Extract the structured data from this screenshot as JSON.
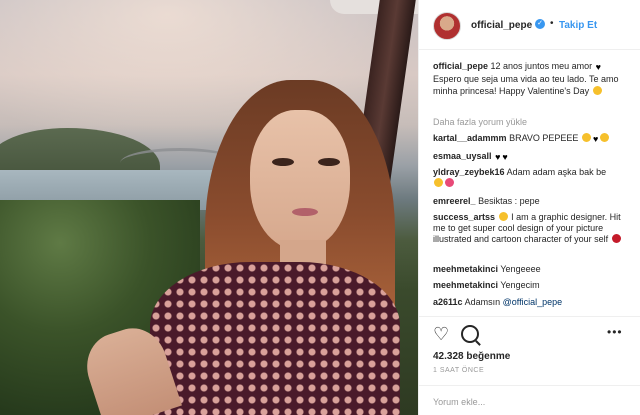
{
  "post": {
    "username": "official_pepe",
    "follow_label": "Takip Et",
    "separator": "•"
  },
  "caption": {
    "user": "official_pepe",
    "text": "12 anos juntos meu amor",
    "text2": "Espero que seja uma vida ao teu lado. Te amo minha princesa! Happy Valentine's Day"
  },
  "more_comments_label": "Daha fazla yorum yükle",
  "comments": [
    {
      "user": "kartal__adammm",
      "text": "BRAVO PEPEEE"
    },
    {
      "user": "esmaa_uysall",
      "text": ""
    },
    {
      "user": "yldray_zeybek16",
      "text": "Adam adam aşka bak be"
    },
    {
      "user": "emreerel_",
      "text": "Besiktas : pepe"
    },
    {
      "user": "success_artss",
      "text": "I am a graphic designer. Hit me to get super cool design of your picture illustrated and cartoon character of your self"
    },
    {
      "user": "meehmetakinci",
      "text": "Yengeeee"
    },
    {
      "user": "meehmetakinci",
      "text": "Yengecim"
    },
    {
      "user": "a2611c",
      "text": "Adamsın",
      "mention": "@official_pepe"
    }
  ],
  "likes_text": "42.328 beğenme",
  "time_text": "1 SAAT ÖNCE",
  "add_comment_placeholder": "Yorum ekle...",
  "options_label": "•••",
  "icons": {
    "like": "heart-outline-icon",
    "comment": "comment-bubble-icon",
    "verified": "verified-badge-icon",
    "options": "more-options-icon"
  },
  "colors": {
    "link_blue": "#3897f0",
    "mention_blue": "#003569",
    "muted": "#999999",
    "text": "#262626"
  }
}
